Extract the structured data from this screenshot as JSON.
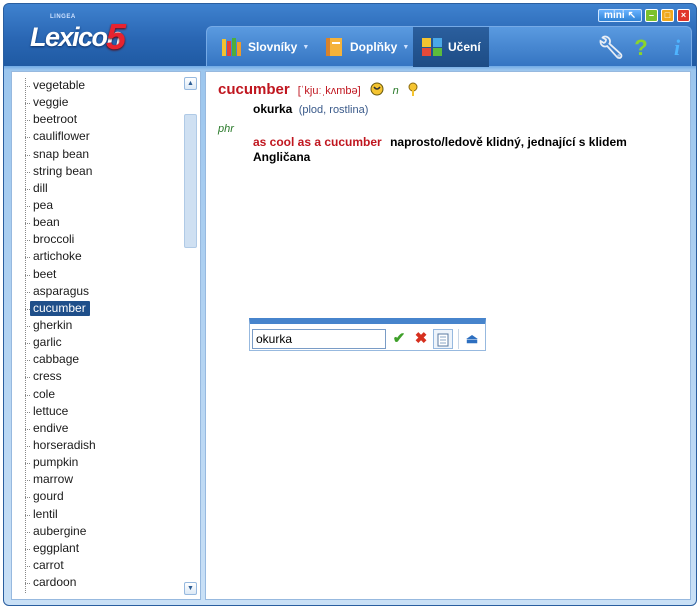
{
  "app": {
    "logo_small": "LINGEA",
    "logo_text": "Lexicon",
    "logo_version": "5"
  },
  "window": {
    "mini_label": "mini"
  },
  "menu": {
    "slovniky": "Slovníky",
    "doplnky": "Doplňky",
    "uceni": "Učení"
  },
  "word_list": [
    "vegetable",
    "veggie",
    "beetroot",
    "cauliflower",
    "snap bean",
    "string bean",
    "dill",
    "pea",
    "bean",
    "broccoli",
    "artichoke",
    "beet",
    "asparagus",
    "cucumber",
    "gherkin",
    "garlic",
    "cabbage",
    "cress",
    "cole",
    "lettuce",
    "endive",
    "horseradish",
    "pumpkin",
    "marrow",
    "gourd",
    "lentil",
    "aubergine",
    "eggplant",
    "carrot",
    "cardoon"
  ],
  "selected_word": "cucumber",
  "entry": {
    "headword": "cucumber",
    "pronunciation": "[ˈkjuːˌkʌmbə]",
    "pos": "n",
    "translation": "okurka",
    "translation_note": "(plod, rostlina)",
    "phr_label": "phr",
    "phrase_en": "as cool as a cucumber",
    "phrase_cz": "naprosto/ledově klidný, jednající s klidem Angličana"
  },
  "learn": {
    "input_value": "okurka"
  }
}
